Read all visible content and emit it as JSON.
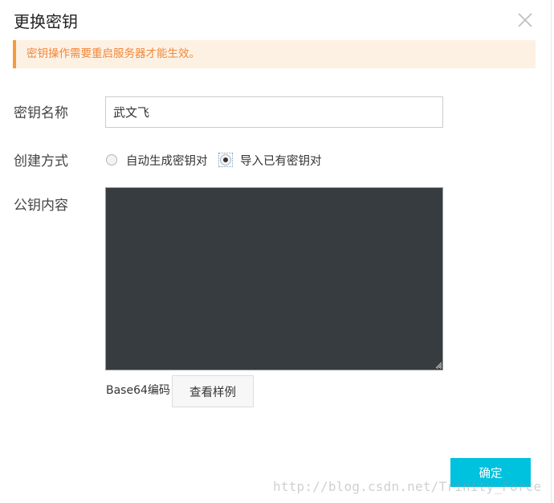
{
  "dialog": {
    "title": "更换密钥",
    "close_icon": "close-icon"
  },
  "alert": {
    "text": "密钥操作需要重启服务器才能生效。",
    "accent_color": "#f59b3b",
    "background_color": "#fdf1e4"
  },
  "form": {
    "name_label": "密钥名称",
    "name_value": "武文飞",
    "method_label": "创建方式",
    "method_options": [
      {
        "label": "自动生成密钥对",
        "checked": false
      },
      {
        "label": "导入已有密钥对",
        "checked": true
      }
    ],
    "pubkey_label": "公钥内容",
    "pubkey_value": "",
    "encoding_text": "Base64编码",
    "sample_button": "查看样例"
  },
  "footer": {
    "ok_button": "确定",
    "ok_color": "#00c1de"
  },
  "watermark": "http://blog.csdn.net/Trinity_Force"
}
